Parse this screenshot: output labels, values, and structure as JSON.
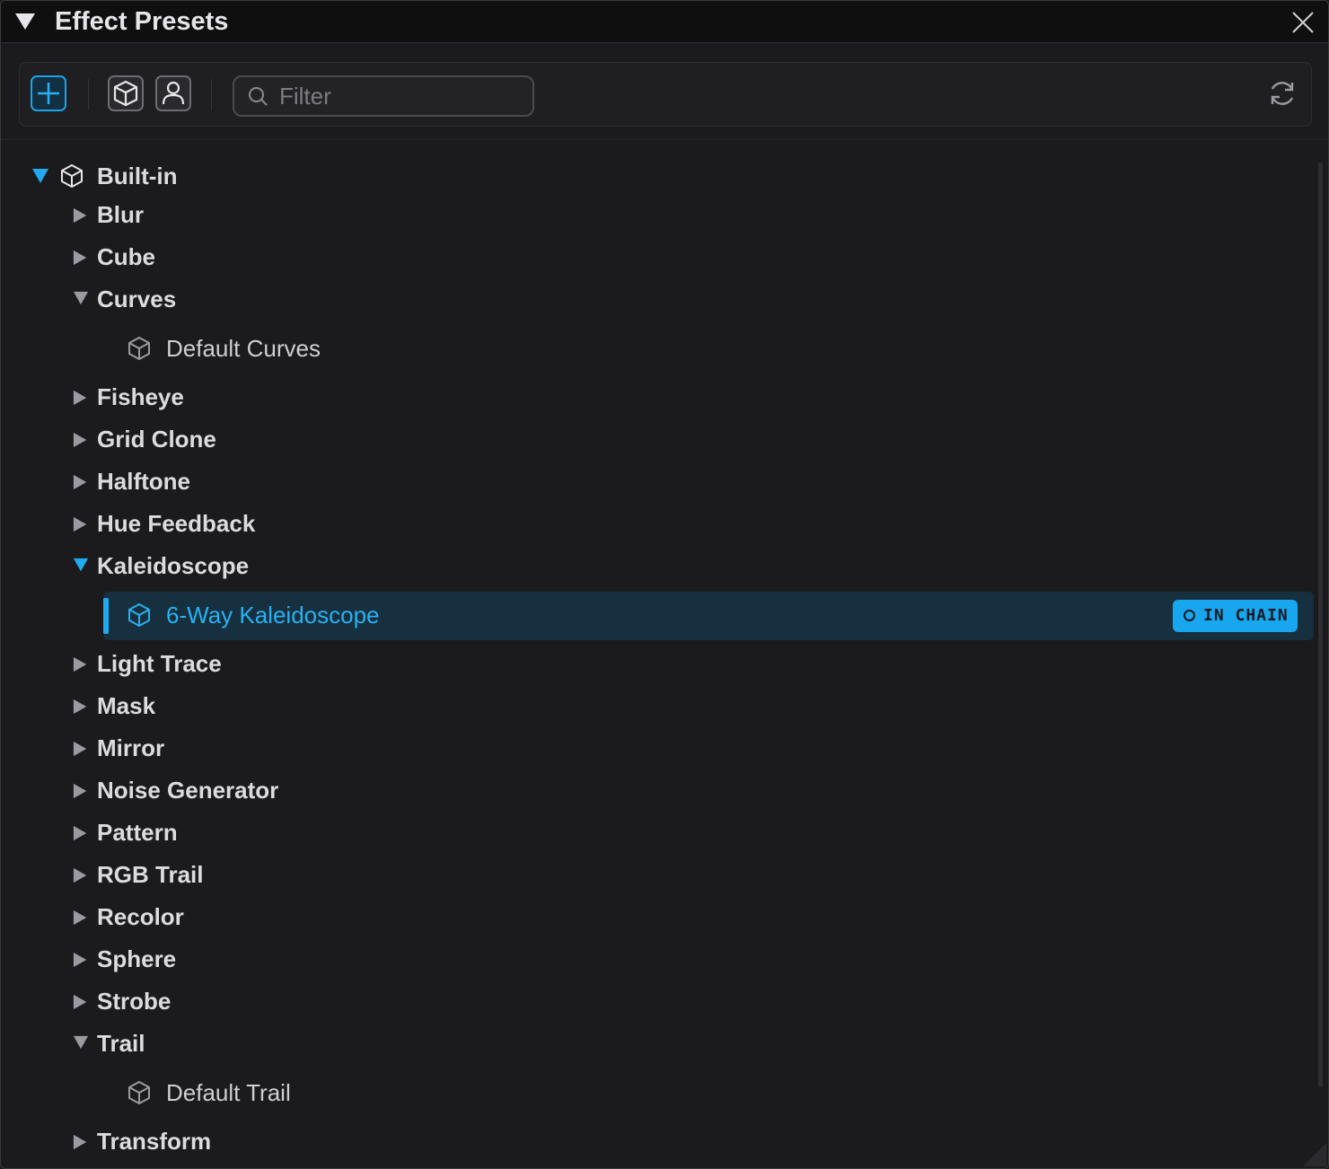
{
  "window": {
    "title": "Effect Presets"
  },
  "toolbar": {
    "add_icon": "plus-icon",
    "builtin_icon": "cube-icon",
    "user_icon": "user-icon",
    "filter_placeholder": "Filter",
    "filter_value": "",
    "refresh_icon": "refresh-icon"
  },
  "colors": {
    "accent": "#1aa3e8",
    "selected_bg": "#16303f",
    "background": "#1b1b1e"
  },
  "tree": {
    "root": {
      "label": "Built-in",
      "expanded": true
    },
    "folders": [
      {
        "label": "Blur",
        "expanded": false
      },
      {
        "label": "Cube",
        "expanded": false
      },
      {
        "label": "Curves",
        "expanded": true,
        "children": [
          "Default Curves"
        ]
      },
      {
        "label": "Fisheye",
        "expanded": false
      },
      {
        "label": "Grid Clone",
        "expanded": false
      },
      {
        "label": "Halftone",
        "expanded": false
      },
      {
        "label": "Hue Feedback",
        "expanded": false
      },
      {
        "label": "Kaleidoscope",
        "expanded": true,
        "children": [
          "6-Way Kaleidoscope"
        ]
      },
      {
        "label": "Light Trace",
        "expanded": false
      },
      {
        "label": "Mask",
        "expanded": false
      },
      {
        "label": "Mirror",
        "expanded": false
      },
      {
        "label": "Noise Generator",
        "expanded": false
      },
      {
        "label": "Pattern",
        "expanded": false
      },
      {
        "label": "RGB Trail",
        "expanded": false
      },
      {
        "label": "Recolor",
        "expanded": false
      },
      {
        "label": "Sphere",
        "expanded": false
      },
      {
        "label": "Strobe",
        "expanded": false
      },
      {
        "label": "Trail",
        "expanded": true,
        "children": [
          "Default Trail"
        ]
      },
      {
        "label": "Transform",
        "expanded": false
      }
    ],
    "selected_badge": "IN CHAIN"
  }
}
